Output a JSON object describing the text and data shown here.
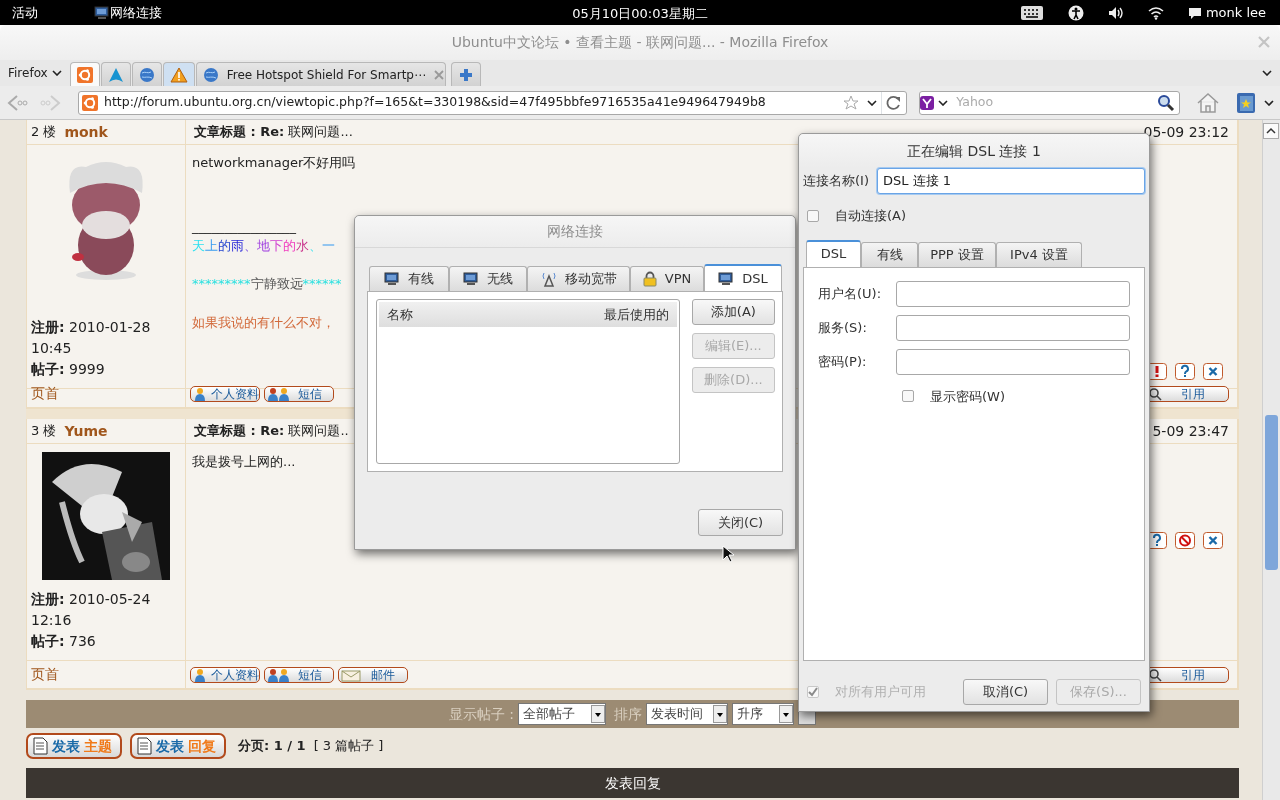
{
  "top_bar": {
    "activities": "活动",
    "app_name": "网络连接",
    "clock": "05月10日00:03星期二",
    "user": "monk lee"
  },
  "browser": {
    "title": "Ubuntu中文论坛 • 查看主题 - 联网问题... - Mozilla Firefox",
    "menu": "Firefox",
    "tabs": [
      {
        "kind": "ubuntu",
        "selected": true
      },
      {
        "kind": "arch",
        "selected": false
      },
      {
        "kind": "globe",
        "selected": false
      },
      {
        "kind": "warning",
        "selected": false
      },
      {
        "kind": "globe",
        "label": "Free Hotspot Shield For Smartp⋯",
        "selected": false
      }
    ],
    "url": "http://forum.ubuntu.org.cn/viewtopic.php?f=165&t=330198&sid=47f495bbfe9716535a41e949647949b8",
    "search": {
      "placeholder": "Yahoo"
    }
  },
  "posts": [
    {
      "floor": "2 楼",
      "author": "monk",
      "subject": "**文章标题 : Re:** 联网问题...",
      "posted": "05-09 23:12",
      "body": "networkmanager不好用吗",
      "signature": {
        "divider": "________________",
        "rainbow": "天上的雨、地下的水、一",
        "motto": {
          "left": "*********",
          "middle": "宁静致远",
          "right": "******"
        },
        "note": "如果我说的有什么不对，"
      },
      "registered": "**注册:** 2010-01-28 10:45",
      "post_count": "**帖子:** 9999",
      "top_link": "页首",
      "actions": [
        {
          "kind": "report"
        },
        {
          "kind": "info"
        },
        {
          "kind": "delete"
        }
      ],
      "buttons": [
        {
          "kind": "profile",
          "label": "个人资料"
        },
        {
          "kind": "message",
          "label": "短信"
        },
        {
          "kind": "quote",
          "label": "引用"
        }
      ]
    },
    {
      "floor": "3 楼",
      "author": "Yume",
      "subject": "**文章标题 : Re:** 联网问题..",
      "posted": "5-09 23:47",
      "body": "我是拨号上网的...",
      "registered": "**注册:** 2010-05-24 12:16",
      "post_count": "**帖子:** 736",
      "top_link": "页首",
      "actions": [
        {
          "kind": "info"
        },
        {
          "kind": "ban"
        },
        {
          "kind": "delete"
        }
      ],
      "buttons": [
        {
          "kind": "profile",
          "label": "个人资料"
        },
        {
          "kind": "message",
          "label": "短信"
        },
        {
          "kind": "email",
          "label": "邮件"
        },
        {
          "kind": "quote",
          "label": "引用"
        }
      ]
    }
  ],
  "sort_bar": {
    "show_label": "显示帖子 :",
    "show_value": "全部帖子",
    "sort_label": "排序",
    "sort_value": "发表时间",
    "order_value": "升序"
  },
  "actions_row": {
    "new_topic": {
      "verb": "发表",
      "noun": "主题"
    },
    "reply": {
      "verb": "发表",
      "noun": "回复"
    },
    "pages": "分页: 1 / 1",
    "count": "[ 3 篇帖子 ]"
  },
  "reply_bar": "发表回复",
  "network_dialog": {
    "title": "网络连接",
    "active": false,
    "tabs": [
      {
        "label": "有线",
        "kind": "wired",
        "selected": false
      },
      {
        "label": "无线",
        "kind": "wired",
        "selected": false
      },
      {
        "label": "移动宽带",
        "kind": "mobile",
        "selected": false
      },
      {
        "label": "VPN",
        "kind": "vpn",
        "selected": false
      },
      {
        "label": "DSL",
        "kind": "wired",
        "selected": true
      }
    ],
    "columns": [
      "名称",
      "最后使用的"
    ],
    "buttons": [
      {
        "label": "添加(A)",
        "disabled": false
      },
      {
        "label": "编辑(E)...",
        "disabled": true
      },
      {
        "label": "删除(D)...",
        "disabled": true
      }
    ],
    "close": "关闭(C)"
  },
  "edit_dialog": {
    "title": "正在编辑 DSL 连接 1",
    "active": true,
    "name_label": "连接名称(I)",
    "name_value": "DSL 连接 1",
    "auto_connect": {
      "label": "自动连接(A)",
      "checked": false
    },
    "tabs": [
      {
        "label": "DSL",
        "selected": true
      },
      {
        "label": "有线",
        "selected": false
      },
      {
        "label": "PPP 设置",
        "selected": false
      },
      {
        "label": "IPv4 设置",
        "selected": false
      }
    ],
    "fields": [
      {
        "label": "用户名(U):"
      },
      {
        "label": "服务(S):"
      },
      {
        "label": "密码(P):"
      }
    ],
    "show_password": {
      "label": "显示密码(W)",
      "checked": false
    },
    "all_users": {
      "label": "对所有用户可用",
      "checked": true,
      "disabled": true
    },
    "buttons": [
      {
        "label": "取消(C)",
        "disabled": false
      },
      {
        "label": "保存(S)...",
        "disabled": true
      }
    ]
  }
}
